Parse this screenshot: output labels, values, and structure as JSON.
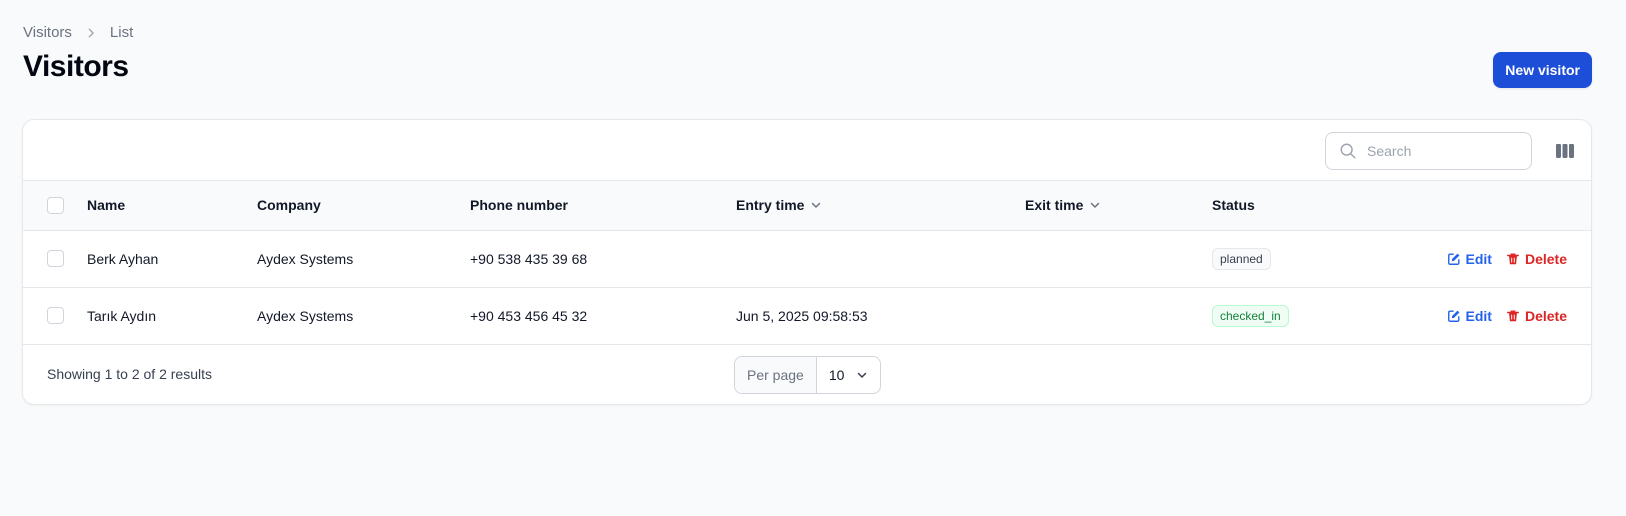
{
  "breadcrumb": {
    "parent": "Visitors",
    "current": "List"
  },
  "page": {
    "title": "Visitors",
    "new_button": "New visitor"
  },
  "toolbar": {
    "search_placeholder": "Search"
  },
  "table": {
    "columns": {
      "name": "Name",
      "company": "Company",
      "phone": "Phone number",
      "entry_time": "Entry time",
      "exit_time": "Exit time",
      "status": "Status"
    },
    "rows": [
      {
        "name": "Berk Ayhan",
        "company": "Aydex Systems",
        "phone": "+90 538 435 39 68",
        "entry_time": "",
        "exit_time": "",
        "status": "planned"
      },
      {
        "name": "Tarık Aydın",
        "company": "Aydex Systems",
        "phone": "+90 453 456 45 32",
        "entry_time": "Jun 5, 2025 09:58:53",
        "exit_time": "",
        "status": "checked_in"
      }
    ],
    "actions": {
      "edit": "Edit",
      "delete": "Delete"
    }
  },
  "footer": {
    "results": "Showing 1 to 2 of 2 results",
    "per_page_label": "Per page",
    "per_page_value": "10"
  },
  "colors": {
    "primary": "#1d4ed8",
    "edit": "#2563eb",
    "delete": "#dc2626",
    "status_planned": "#374151",
    "status_checked_in": "#15803d"
  },
  "icons": {
    "breadcrumb_separator": "chevron-right-icon",
    "search": "search-icon",
    "columns": "columns-icon",
    "sort": "chevron-down-icon",
    "edit": "pencil-square-icon",
    "delete": "trash-icon",
    "per_page": "chevron-down-icon"
  }
}
